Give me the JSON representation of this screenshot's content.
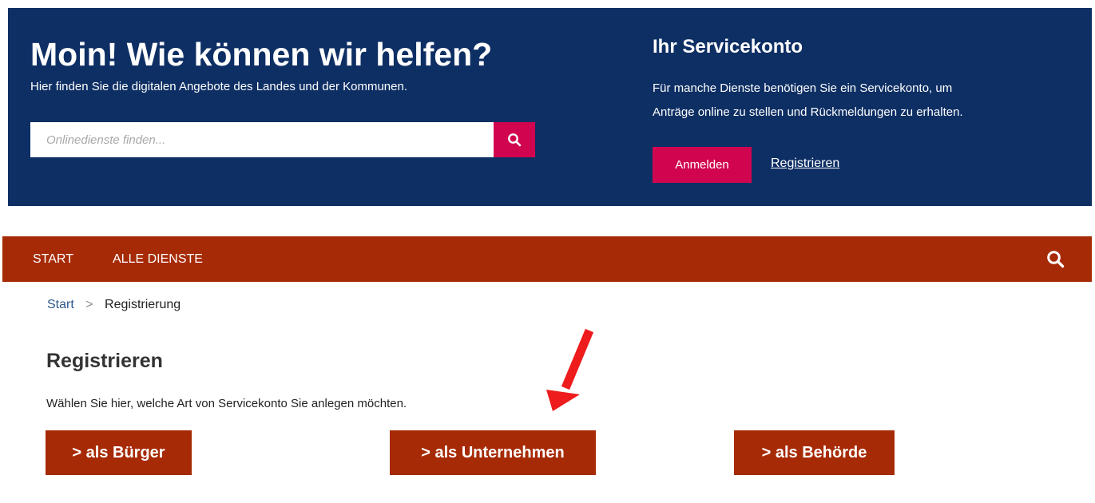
{
  "hero": {
    "title": "Moin! Wie können wir helfen?",
    "subtitle": "Hier finden Sie die digitalen Angebote des Landes und der Kommunen.",
    "search_placeholder": "Onlinedienste finden...",
    "search_icon": "search-icon"
  },
  "account": {
    "title": "Ihr Servicekonto",
    "text_line1": "Für manche Dienste benötigen Sie ein Servicekonto, um",
    "text_line2": "Anträge online zu stellen und Rückmeldungen zu erhalten.",
    "login_label": "Anmelden",
    "register_label": "Registrieren"
  },
  "nav": {
    "items": [
      {
        "label": "START"
      },
      {
        "label": "ALLE DIENSTE"
      }
    ],
    "search_icon": "search-icon"
  },
  "breadcrumb": {
    "home": "Start",
    "separator": ">",
    "current": "Registrierung"
  },
  "main": {
    "title": "Registrieren",
    "intro": "Wählen Sie hier, welche Art von Servicekonto Sie anlegen möchten.",
    "options": [
      {
        "label": "> als Bürger"
      },
      {
        "label": "> als Unternehmen"
      },
      {
        "label": "> als Behörde"
      }
    ]
  },
  "colors": {
    "hero_background": "#0e2f64",
    "accent_pink": "#d1054f",
    "nav_background": "#a72a06",
    "annotation_arrow": "#ee1c1c"
  }
}
